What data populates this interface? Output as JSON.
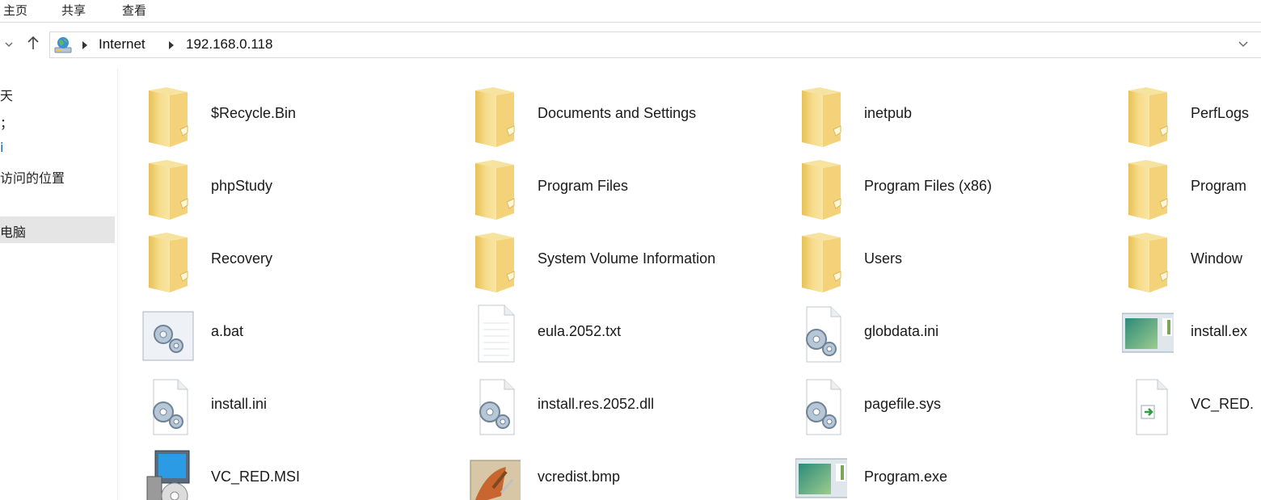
{
  "ribbon": {
    "tabs": [
      "主页",
      "共享",
      "查看"
    ]
  },
  "address": {
    "location_icon": "network-globe-icon",
    "crumbs": [
      "Internet",
      "192.168.0.118"
    ],
    "dropdown_icon": "chevron-down-icon"
  },
  "sidebar": {
    "items": [
      "天",
      "；",
      "i",
      "访问的位置",
      "电脑"
    ],
    "selected": "电脑"
  },
  "files": [
    {
      "name": "$Recycle.Bin",
      "icon": "folder-icon"
    },
    {
      "name": "Documents and Settings",
      "icon": "folder-icon"
    },
    {
      "name": "inetpub",
      "icon": "folder-icon"
    },
    {
      "name": "PerfLogs",
      "icon": "folder-icon"
    },
    {
      "name": "phpStudy",
      "icon": "folder-icon"
    },
    {
      "name": "Program Files",
      "icon": "folder-icon"
    },
    {
      "name": "Program Files (x86)",
      "icon": "folder-icon"
    },
    {
      "name": "Program",
      "icon": "folder-icon"
    },
    {
      "name": "Recovery",
      "icon": "folder-icon"
    },
    {
      "name": "System Volume Information",
      "icon": "folder-icon"
    },
    {
      "name": "Users",
      "icon": "folder-icon"
    },
    {
      "name": "Window",
      "icon": "folder-icon"
    },
    {
      "name": "a.bat",
      "icon": "batch-file-icon"
    },
    {
      "name": "eula.2052.txt",
      "icon": "text-file-icon"
    },
    {
      "name": "globdata.ini",
      "icon": "settings-file-icon"
    },
    {
      "name": "install.ex",
      "icon": "application-icon"
    },
    {
      "name": "install.ini",
      "icon": "settings-file-icon"
    },
    {
      "name": "install.res.2052.dll",
      "icon": "settings-file-icon"
    },
    {
      "name": "pagefile.sys",
      "icon": "settings-file-icon"
    },
    {
      "name": "VC_RED.",
      "icon": "shortcut-file-icon"
    },
    {
      "name": "VC_RED.MSI",
      "icon": "installer-icon"
    },
    {
      "name": "vcredist.bmp",
      "icon": "image-file-icon"
    },
    {
      "name": "Program.exe",
      "icon": "application-icon"
    }
  ]
}
